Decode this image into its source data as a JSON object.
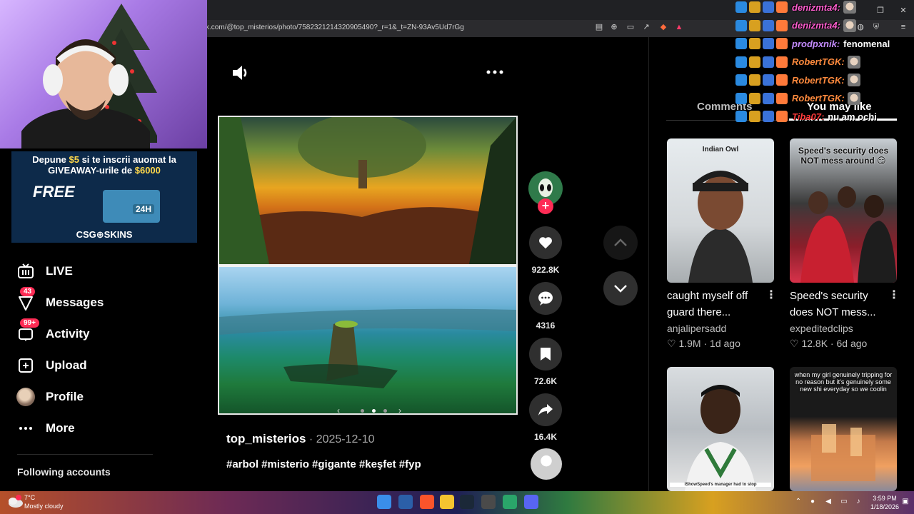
{
  "browser": {
    "url": "k.com/@top_misterios/photo/7582321214320905490?_r=1&_t=ZN-93Av5Ud7rGg"
  },
  "promo": {
    "line1_pre": "Depune ",
    "line1_amount": "$5",
    "line1_post": " si te inscrii auomat la",
    "line2_pre": "GIVEAWAY-urile de ",
    "line2_amount": "$6000",
    "free": "FREE",
    "box_label": "24H",
    "brand": "CSG⊕SKINS"
  },
  "sidebar": {
    "items": [
      {
        "label": "LIVE",
        "icon": "live-tv-icon",
        "badge": ""
      },
      {
        "label": "Messages",
        "icon": "messages-icon",
        "badge": "43"
      },
      {
        "label": "Activity",
        "icon": "activity-icon",
        "badge": "99+"
      },
      {
        "label": "Upload",
        "icon": "upload-icon",
        "badge": ""
      },
      {
        "label": "Profile",
        "icon": "avatar",
        "badge": ""
      },
      {
        "label": "More",
        "icon": "more-dots-icon",
        "badge": ""
      }
    ],
    "following_title": "Following accounts"
  },
  "post": {
    "author": "top_misterios",
    "separator": " · ",
    "date": "2025-12-10",
    "tags": "#arbol #misterio #gigante #keşfet #fyp",
    "carousel_prev": "‹",
    "carousel_next": "›",
    "slide_count": 3,
    "active_slide": 2
  },
  "actions": {
    "likes": "922.8K",
    "comments": "4316",
    "saves": "72.6K",
    "shares": "16.4K",
    "follow": "+"
  },
  "right_panel": {
    "tab_comments": "Comments",
    "tab_you_may_like": "You may like",
    "cards": [
      {
        "thumb_caption": "Indian Owl",
        "title": "caught myself off guard there...",
        "author": "anjalipersadd",
        "likes": "1.9M",
        "age": "1d ago"
      },
      {
        "thumb_caption": "Speed's security does NOT mess around 😏",
        "title": "Speed's security does NOT mess...",
        "author": "expeditedclips",
        "likes": "12.8K",
        "age": "6d ago"
      },
      {
        "thumb_caption": "iShowSpeed's manager had to stop",
        "title": "",
        "author": "",
        "likes": "",
        "age": ""
      },
      {
        "thumb_caption": "when my girl genuinely tripping for no reason but it's genuinely some new shi everyday so we coolin",
        "title": "",
        "author": "",
        "likes": "",
        "age": ""
      }
    ],
    "stat_separator": " · "
  },
  "chat": [
    {
      "name": "denizmta4:",
      "color": "#ff5fd0",
      "message": ""
    },
    {
      "name": "denizmta4:",
      "color": "#ff5fd0",
      "message": ""
    },
    {
      "name": "prodpxnik:",
      "color": "#c58cff",
      "message": "fenomenal"
    },
    {
      "name": "RobertTGK:",
      "color": "#ff8a3d",
      "message": ""
    },
    {
      "name": "RobertTGK:",
      "color": "#ff8a3d",
      "message": ""
    },
    {
      "name": "RobertTGK:",
      "color": "#ff8a3d",
      "message": ""
    },
    {
      "name": "Tiba07:",
      "color": "#ff3b3b",
      "message": "nu am ochi"
    }
  ],
  "taskbar": {
    "temp": "7°C",
    "weather": "Mostly cloudy",
    "time": "3:59 PM",
    "date": "1/18/2026"
  },
  "colors": {
    "accent": "#fe2c55",
    "background": "#000000",
    "promo_amount": "#ffd84a"
  }
}
